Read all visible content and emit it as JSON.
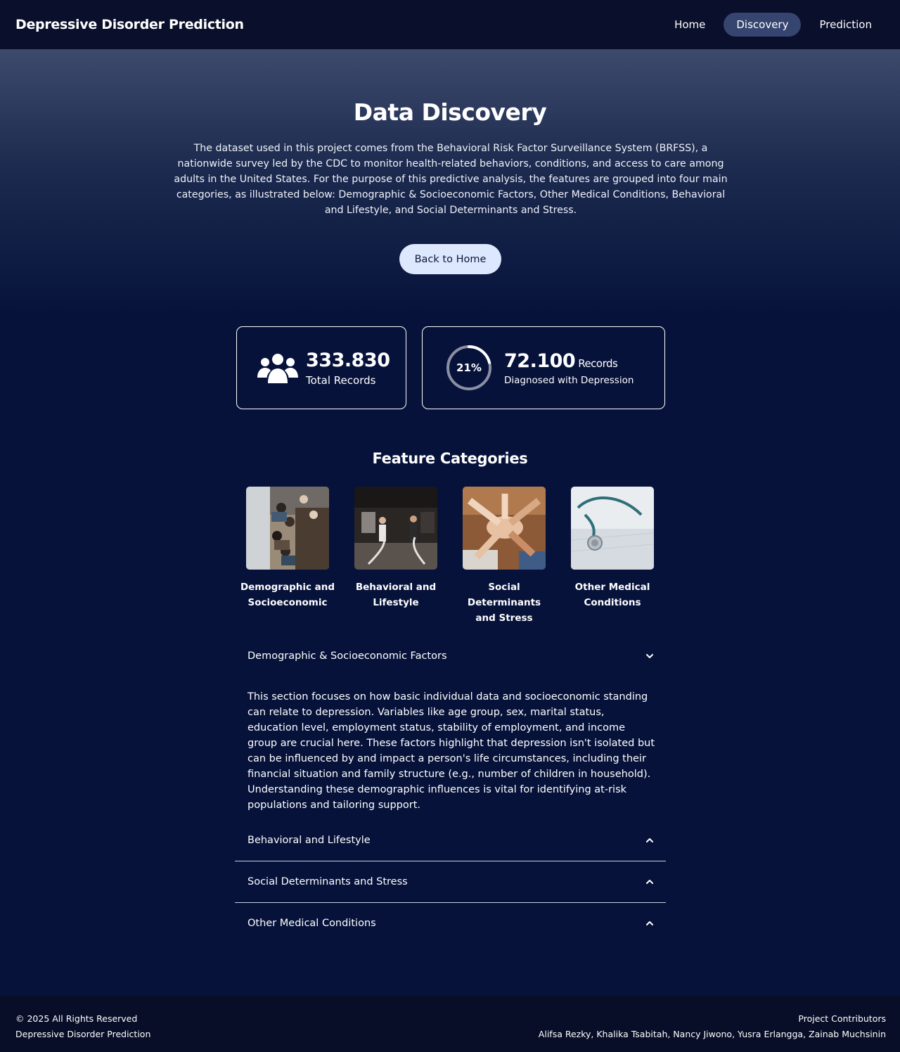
{
  "nav": {
    "brand": "Depressive Disorder Prediction",
    "links": [
      {
        "label": "Home",
        "active": false
      },
      {
        "label": "Discovery",
        "active": true
      },
      {
        "label": "Prediction",
        "active": false
      }
    ]
  },
  "hero": {
    "title": "Data Discovery",
    "intro": "The dataset used in this project comes from the Behavioral Risk Factor Surveillance System (BRFSS), a nationwide survey led by the CDC to monitor health-related behaviors, conditions, and access to care among adults in the United States. For the purpose of this predictive analysis, the features are grouped into four main categories, as illustrated below: Demographic & Socioeconomic Factors, Other Medical Conditions, Behavioral and Lifestyle, and Social Determinants and Stress.",
    "back_button": "Back to Home"
  },
  "stats": {
    "total": {
      "value": "333.830",
      "label": "Total Records",
      "icon": "users-icon"
    },
    "depression": {
      "percent_label": "21%",
      "percent": 0.21,
      "value": "72.100",
      "unit": "Records",
      "label": "Diagnosed with Depression"
    }
  },
  "features": {
    "title": "Feature Categories",
    "items": [
      {
        "line1": "Demographic and",
        "line2": "Socioeconomic",
        "image": "crowd-photo"
      },
      {
        "line1": "Behavioral and",
        "line2": "Lifestyle",
        "image": "gym-photo"
      },
      {
        "line1": "Social Determinants",
        "line2": "and Stress",
        "image": "hands-photo"
      },
      {
        "line1": "Other Medical",
        "line2": "Conditions",
        "image": "stethoscope-photo"
      }
    ]
  },
  "accordion": {
    "items": [
      {
        "title": "Demographic & Socioeconomic Factors",
        "expanded": true
      },
      {
        "title": "Behavioral and Lifestyle",
        "expanded": false
      },
      {
        "title": "Social Determinants and Stress",
        "expanded": false
      },
      {
        "title": "Other Medical Conditions",
        "expanded": false
      }
    ],
    "body": "This section focuses on how basic individual data and socioeconomic standing can relate to depression. Variables like age group, sex, marital status, education level, employment status, stability of employment, and income group are crucial here. These factors highlight that depression isn't isolated but can be influenced by and impact a person's life circumstances, including their financial situation and family structure (e.g., number of children in household). Understanding these demographic influences is vital for identifying at-risk populations and tailoring support."
  },
  "footer": {
    "copyright": "© 2025 All Rights Reserved",
    "project": "Depressive Disorder Prediction",
    "contributors_title": "Project Contributors",
    "contributors": "Alifsa Rezky, Khalika Tsabitah, Nancy Jiwono, Yusra Erlangga, Zainab Muchsinin"
  },
  "colors": {
    "background": "#06123a",
    "navbar": "#0a0f2b",
    "nav_active": "#36456f",
    "button": "#dde8ff",
    "footer": "#080d28"
  }
}
